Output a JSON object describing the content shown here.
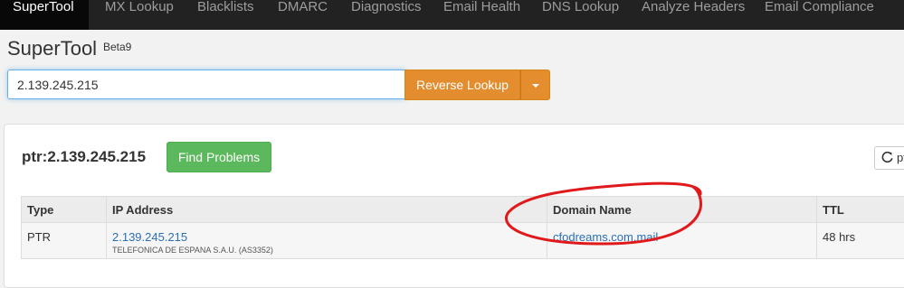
{
  "nav": {
    "items": [
      {
        "label": "SuperTool"
      },
      {
        "label": "MX Lookup"
      },
      {
        "label": "Blacklists"
      },
      {
        "label": "DMARC"
      },
      {
        "label": "Diagnostics"
      },
      {
        "label": "Email Health"
      },
      {
        "label": "DNS Lookup"
      },
      {
        "label": "Analyze Headers"
      },
      {
        "label": "Email Compliance"
      }
    ]
  },
  "page": {
    "title": "SuperTool",
    "badge": "Beta9"
  },
  "search": {
    "value": "2.139.245.215",
    "button_label": "Reverse Lookup"
  },
  "result": {
    "heading": "ptr:2.139.245.215",
    "find_button": "Find Problems",
    "refresh_label": "pt",
    "table": {
      "headers": [
        "Type",
        "IP Address",
        "Domain Name",
        "TTL"
      ],
      "rows": [
        {
          "type": "PTR",
          "ip": "2.139.245.215",
          "asn": "TELEFONICA DE ESPANA S.A.U. (AS3352)",
          "domain": "cfodreams.com.mail",
          "ttl": "48 hrs"
        }
      ]
    }
  },
  "colors": {
    "navbar": "#222222",
    "accent_orange": "#e38d2f",
    "success_green": "#5cb85c",
    "link_blue": "#2a6fb6",
    "annotation_red": "#e0191b"
  },
  "icons": {
    "refresh": "refresh-icon",
    "caret": "caret-down-icon"
  }
}
